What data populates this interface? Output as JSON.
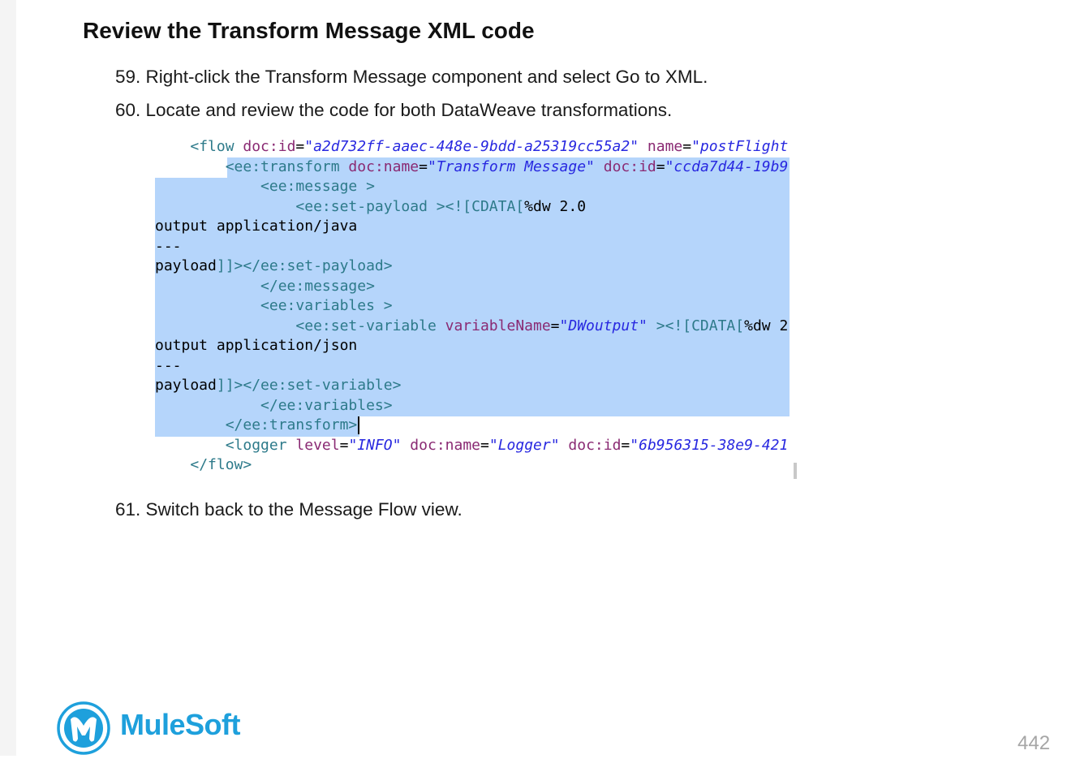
{
  "heading": "Review the Transform Message XML code",
  "steps": [
    "59. Right-click the Transform Message component and select Go to XML.",
    "60. Locate and review the code for both DataWeave transformations.",
    "61. Switch back to the Message Flow view."
  ],
  "code": {
    "lines": [
      [
        "    ",
        "<flow",
        " doc:id",
        "=",
        "\"a2d732ff-aaec-448e-9bdd-a25319cc55a2\"",
        " name",
        "=",
        "\"postFlight"
      ],
      [
        "        ",
        "<ee:transform",
        " doc:name",
        "=",
        "\"Transform Message\"",
        " doc:id",
        "=",
        "\"ccda7d44-19b9"
      ],
      [
        "            ",
        "<ee:message >"
      ],
      [
        "                ",
        "<ee:set-payload >",
        "<![CDATA[",
        "%dw 2.0"
      ],
      [
        "output application/java"
      ],
      [
        "---"
      ],
      [
        "payload",
        "]]>",
        "</ee:set-payload>"
      ],
      [
        "            ",
        "</ee:message>"
      ],
      [
        "            ",
        "<ee:variables >"
      ],
      [
        "                ",
        "<ee:set-variable",
        " variableName",
        "=",
        "\"DWoutput\"",
        " >",
        "<![CDATA[",
        "%dw 2"
      ],
      [
        "output application/json"
      ],
      [
        "---"
      ],
      [
        "payload",
        "]]>",
        "</ee:set-variable>"
      ],
      [
        "            ",
        "</ee:variables>"
      ],
      [
        "        ",
        "</ee:transform>"
      ],
      [
        "        ",
        "<logger",
        " level",
        "=",
        "\"INFO\"",
        " doc:name",
        "=",
        "\"Logger\"",
        " doc:id",
        "=",
        "\"6b956315-38e9-421"
      ],
      [
        "    ",
        "</flow>"
      ]
    ]
  },
  "logo": {
    "text": "MuleSoft",
    "color": "#1ea0dc"
  },
  "page_number": "442"
}
